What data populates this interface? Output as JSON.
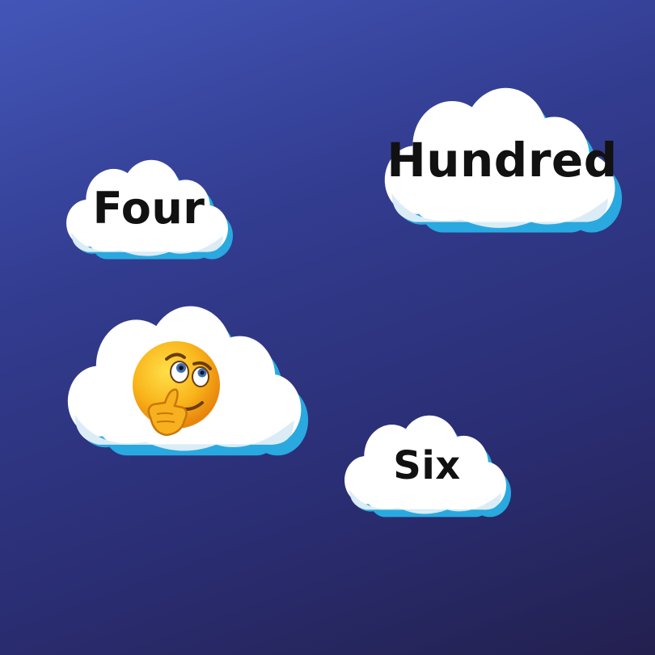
{
  "clouds": [
    {
      "id": "four",
      "word": "Four"
    },
    {
      "id": "hundred",
      "word": "Hundred"
    },
    {
      "id": "six",
      "word": "Six"
    }
  ],
  "mystery_cloud": {
    "icon": "thinking-face-icon"
  },
  "colors": {
    "cloud_fill": "#ffffff",
    "cloud_shade": "#dcecf6",
    "cloud_rim": "#29a9df",
    "word": "#111111"
  }
}
